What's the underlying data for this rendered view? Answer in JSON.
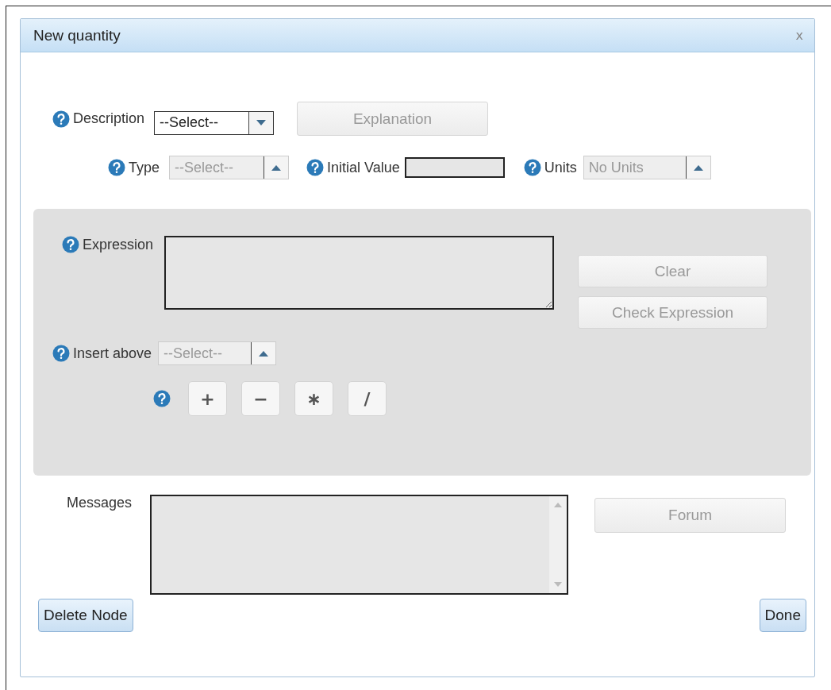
{
  "window": {
    "title": "New quantity",
    "close": "x"
  },
  "description": {
    "label": "Description",
    "select": {
      "value": "--Select--",
      "disabled": false
    }
  },
  "explanation_button": {
    "label": "Explanation",
    "disabled": true
  },
  "type": {
    "label": "Type",
    "select": {
      "value": "--Select--",
      "disabled": true
    }
  },
  "initial_value": {
    "label": "Initial Value"
  },
  "units": {
    "label": "Units",
    "select": {
      "value": "No Units",
      "disabled": true
    }
  },
  "expression": {
    "label": "Expression"
  },
  "expression_buttons": [
    {
      "label": "Clear",
      "disabled": true
    },
    {
      "label": "Check Expression",
      "disabled": true
    }
  ],
  "insert_above": {
    "label": "Insert above",
    "select": {
      "value": "--Select--",
      "disabled": true
    }
  },
  "operators": [
    "+",
    "−",
    "∗",
    "/"
  ],
  "messages": {
    "label": "Messages"
  },
  "forum_button": {
    "label": "Forum",
    "disabled": true
  },
  "footer_buttons": [
    {
      "label": "Delete Node"
    },
    {
      "label": "Done"
    }
  ]
}
